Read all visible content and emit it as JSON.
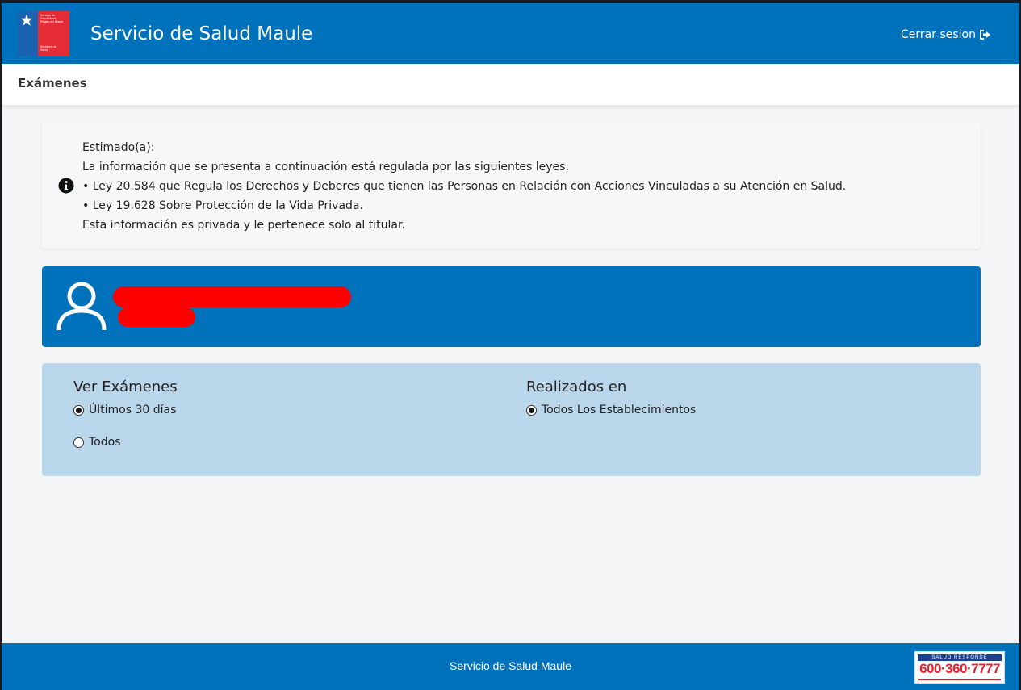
{
  "header": {
    "title": "Servicio de Salud Maule",
    "logout_label": "Cerrar sesion",
    "logo_text": [
      "Servicio de",
      "Salud Maule",
      "Región del Maule",
      "Ministerio de",
      "Salud"
    ]
  },
  "section": {
    "title": "Exámenes"
  },
  "notice": {
    "lines": [
      "Estimado(a):",
      "La información que se presenta a continuación está regulada por las siguientes leyes:",
      "• Ley 20.584 que Regula los Derechos y Deberes que tienen las Personas en Relación con Acciones Vinculadas a su Atención en Salud.",
      "• Ley 19.628 Sobre Protección de la Vida Privada.",
      "Esta información es privada y le pertenece solo al titular."
    ]
  },
  "filters": {
    "ver_examenes": {
      "title": "Ver Exámenes",
      "options": [
        {
          "label": "Últimos 30 días",
          "checked": true
        },
        {
          "label": "Todos",
          "checked": false
        }
      ]
    },
    "realizados_en": {
      "title": "Realizados en",
      "options": [
        {
          "label": "Todos Los Establecimientos",
          "checked": true
        }
      ]
    }
  },
  "footer": {
    "text": "Servicio de Salud Maule",
    "logo_top": "SALUD RESPONDE",
    "logo_number": "600·360·7777"
  },
  "colors": {
    "primary": "#0072bc",
    "filter_bg": "#bad6ea",
    "redaction": "#ff0000"
  }
}
